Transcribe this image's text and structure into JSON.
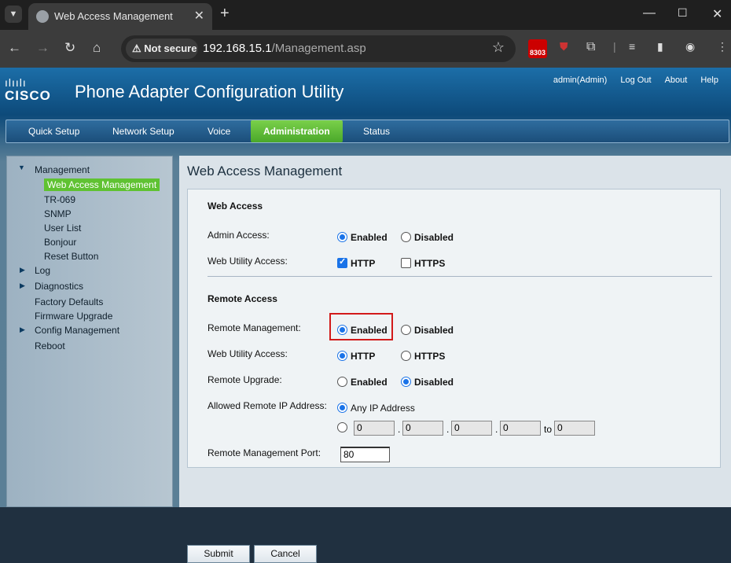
{
  "browser": {
    "tab_title": "Web Access Management",
    "not_secure": "Not secure",
    "url_host": "192.168.15.1",
    "url_path": "/Management.asp",
    "ext_badge": "8303"
  },
  "header": {
    "logo_text": "CISCO",
    "app_title": "Phone Adapter Configuration Utility",
    "user": "admin(Admin)",
    "logout": "Log Out",
    "about": "About",
    "help": "Help"
  },
  "menu": {
    "items": [
      "Quick Setup",
      "Network Setup",
      "Voice",
      "Administration",
      "Status"
    ],
    "active": "Administration"
  },
  "sidebar": {
    "management": "Management",
    "sub": [
      "Web Access Management",
      "TR-069",
      "SNMP",
      "User List",
      "Bonjour",
      "Reset Button"
    ],
    "log": "Log",
    "diagnostics": "Diagnostics",
    "factory": "Factory Defaults",
    "firmware": "Firmware Upgrade",
    "config": "Config Management",
    "reboot": "Reboot"
  },
  "main": {
    "title": "Web Access Management",
    "web_access": {
      "heading": "Web Access",
      "admin_access_label": "Admin Access:",
      "admin_enabled": "Enabled",
      "admin_disabled": "Disabled",
      "web_utility_label": "Web Utility Access:",
      "http": "HTTP",
      "https": "HTTPS"
    },
    "remote_access": {
      "heading": "Remote Access",
      "remote_mgmt_label": "Remote Management:",
      "enabled": "Enabled",
      "disabled": "Disabled",
      "web_utility_label": "Web Utility Access:",
      "http": "HTTP",
      "https": "HTTPS",
      "remote_upgrade_label": "Remote Upgrade:",
      "upgrade_enabled": "Enabled",
      "upgrade_disabled": "Disabled",
      "allowed_ip_label": "Allowed Remote IP Address:",
      "any_ip": "Any IP Address",
      "ip": [
        "0",
        "0",
        "0",
        "0"
      ],
      "ip_to": "0",
      "to_label": "to",
      "dot": ".",
      "port_label": "Remote Management Port:",
      "port_value": "80"
    },
    "submit": "Submit",
    "cancel": "Cancel"
  }
}
